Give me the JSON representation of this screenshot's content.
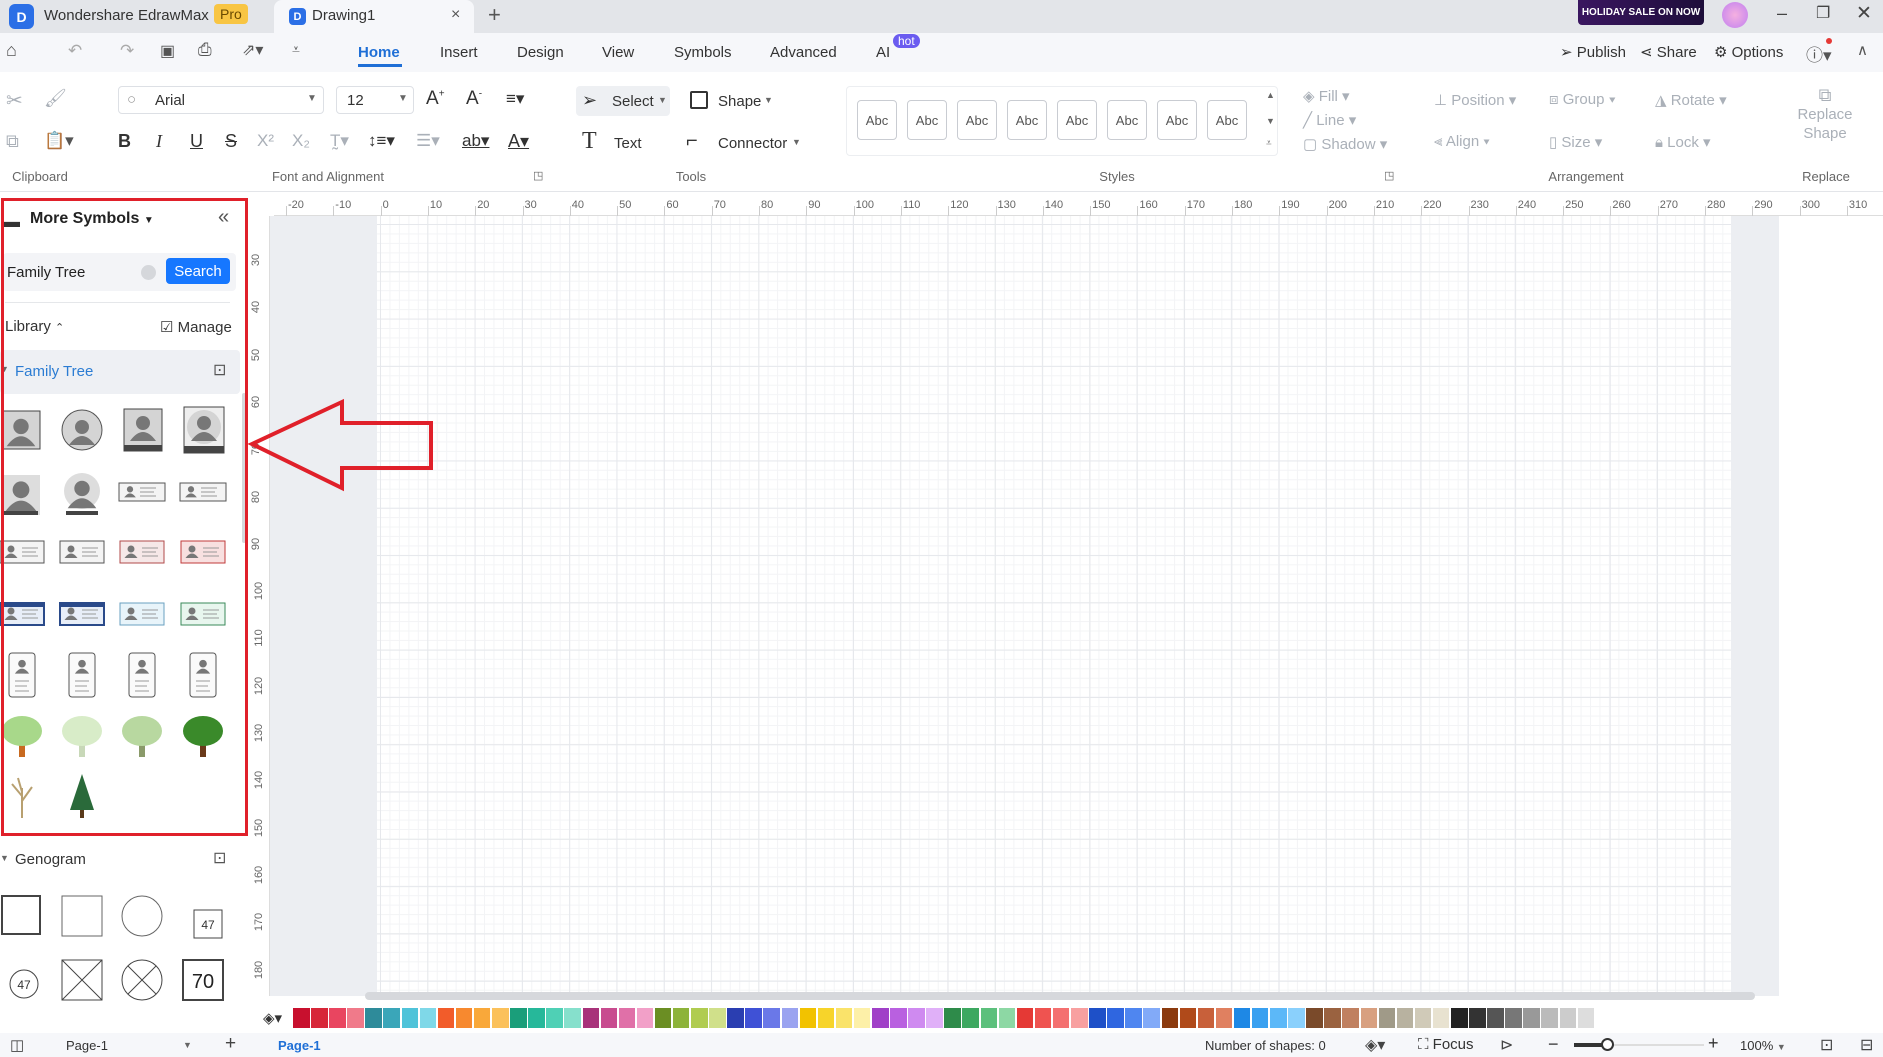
{
  "titlebar": {
    "app_name": "Wondershare EdrawMax",
    "pro_badge": "Pro",
    "doc_tab": "Drawing1",
    "promo": "HOLIDAY SALE ON NOW"
  },
  "menu": {
    "tabs": [
      "Home",
      "Insert",
      "Design",
      "View",
      "Symbols",
      "Advanced",
      "AI"
    ],
    "active_tab": "Home",
    "ai_badge": "hot",
    "publish": "Publish",
    "share": "Share",
    "options": "Options"
  },
  "ribbon": {
    "groups": {
      "clipboard": "Clipboard",
      "font": "Font and Alignment",
      "tools": "Tools",
      "styles": "Styles",
      "arrangement": "Arrangement",
      "replace": "Replace"
    },
    "font_family": "Arial",
    "font_size": "12",
    "format_buttons": [
      "B",
      "I",
      "U",
      "S",
      "X²",
      "X₂"
    ],
    "select": "Select",
    "shape": "Shape",
    "text": "Text",
    "connector": "Connector",
    "style_swatch": "Abc",
    "fill": "Fill",
    "line": "Line",
    "shadow": "Shadow",
    "position": "Position",
    "group": "Group",
    "rotate": "Rotate",
    "align": "Align",
    "size": "Size",
    "lock": "Lock",
    "replace_shape_1": "Replace",
    "replace_shape_2": "Shape"
  },
  "panel": {
    "title": "More Symbols",
    "search_value": "Family Tree",
    "search_button": "Search",
    "library": "Library",
    "manage": "Manage",
    "sections": [
      {
        "name": "Family Tree",
        "expanded": true
      },
      {
        "name": "Genogram",
        "expanded": true
      }
    ],
    "genogram_labels": [
      "47",
      "47",
      "70"
    ]
  },
  "ruler": {
    "horizontal": [
      "-20",
      "-10",
      "0",
      "10",
      "20",
      "30",
      "40",
      "50",
      "60",
      "70",
      "80",
      "90",
      "100",
      "110",
      "120",
      "130",
      "140",
      "150",
      "160",
      "170",
      "180",
      "190",
      "200",
      "210",
      "220",
      "230",
      "240",
      "250",
      "260",
      "270",
      "280",
      "290",
      "300",
      "310"
    ],
    "vertical": [
      "30",
      "40",
      "50",
      "60",
      "70",
      "80",
      "90",
      "100",
      "110",
      "120",
      "130",
      "140",
      "150",
      "160",
      "170",
      "180"
    ]
  },
  "palette": [
    "#c8102e",
    "#d72638",
    "#e94560",
    "#f07a8a",
    "#2e8b9a",
    "#3aa6b9",
    "#4fc3d9",
    "#7fd8e8",
    "#f25c2a",
    "#f7892f",
    "#f9a83a",
    "#fbc15b",
    "#1a9e7a",
    "#26b89a",
    "#4fd0b5",
    "#86e0cc",
    "#a8327a",
    "#c84b8f",
    "#e070a8",
    "#f2a0c8",
    "#6b8e23",
    "#8db33a",
    "#b0cc50",
    "#d0e08a",
    "#2a3eb1",
    "#3f51d6",
    "#6a78e8",
    "#9aa3f0",
    "#f2c200",
    "#f7d42a",
    "#fae36a",
    "#fdf0a8",
    "#a040c8",
    "#b960e0",
    "#cf8af0",
    "#e0b0f8",
    "#2e8b4a",
    "#3da860",
    "#5cc07c",
    "#8dd8a4",
    "#e53935",
    "#ef5350",
    "#f47070",
    "#f8a0a0",
    "#1e50c8",
    "#2f66e0",
    "#4f86f0",
    "#82aaf8",
    "#8b3a0e",
    "#b04a1a",
    "#c8603a",
    "#e08060",
    "#1e88e5",
    "#39a0f0",
    "#5cb8f8",
    "#8ad0fc",
    "#7a4a2a",
    "#9a6240",
    "#c08060",
    "#d8a080",
    "#a09a88",
    "#b8b2a0",
    "#d0cab8",
    "#e8e2d0",
    "#222222",
    "#333333",
    "#555555",
    "#777777",
    "#999999",
    "#bbbbbb",
    "#cccccc",
    "#dddddd"
  ],
  "status": {
    "page_select": "Page-1",
    "page_tab": "Page-1",
    "shapes": "Number of shapes: 0",
    "focus": "Focus",
    "zoom": "100%",
    "zoom_level_percent": 100
  },
  "colors": {
    "accent": "#1f6fd6",
    "search_button": "#1677ff",
    "highlight_frame": "#e0202a",
    "section_text": "#2b7cd3"
  }
}
